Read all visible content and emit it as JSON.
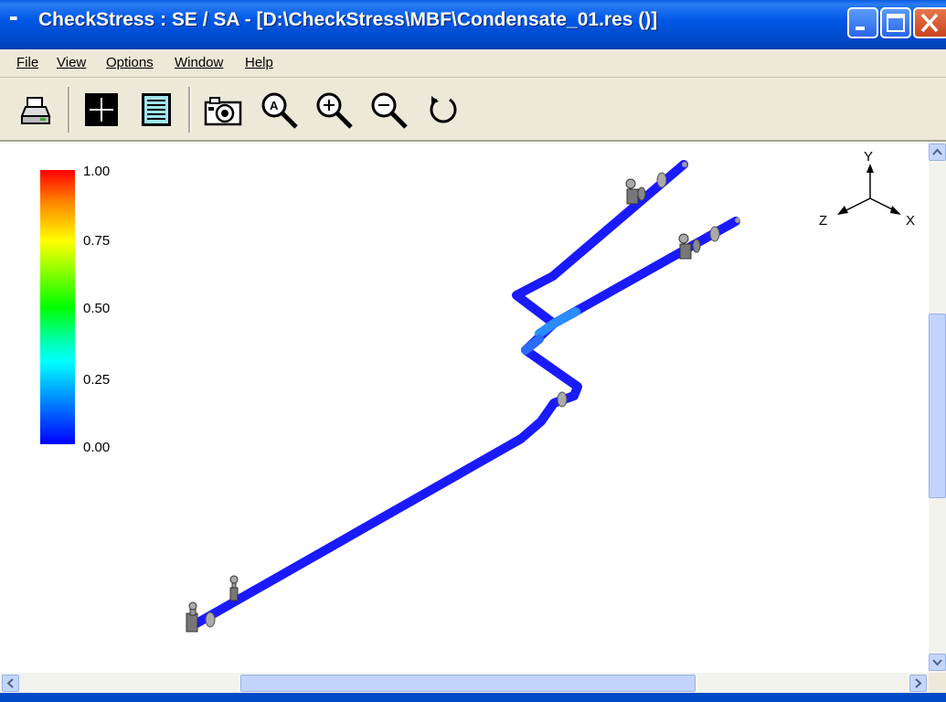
{
  "window": {
    "title": "CheckStress : SE / SA -  [D:\\CheckStress\\MBF\\Condensate_01.res ()]",
    "title_icon": "▪▪",
    "controls": [
      "minimize-icon",
      "maximize-icon",
      "close-icon"
    ]
  },
  "menu": {
    "items": [
      {
        "label": "File"
      },
      {
        "label": "View"
      },
      {
        "label": "Options"
      },
      {
        "label": "Window"
      },
      {
        "label": "Help"
      }
    ]
  },
  "toolbar": {
    "tools": [
      "print-icon",
      "crosshair-icon",
      "document-icon",
      "camera-icon",
      "zoom-auto-icon",
      "zoom-in-icon",
      "zoom-out-icon",
      "rotate-icon"
    ]
  },
  "legend": {
    "labels": [
      "1.00",
      "0.75",
      "0.50",
      "0.25",
      "0.00"
    ],
    "colors": [
      "#ff0000",
      "#ffff00",
      "#00ff00",
      "#00ffff",
      "#0000ff"
    ]
  },
  "axes": {
    "y": "Y",
    "z": "Z",
    "x": "X"
  },
  "colors": {
    "pipe": "#1a1aff",
    "pipe_stress": "#2a8cff"
  }
}
